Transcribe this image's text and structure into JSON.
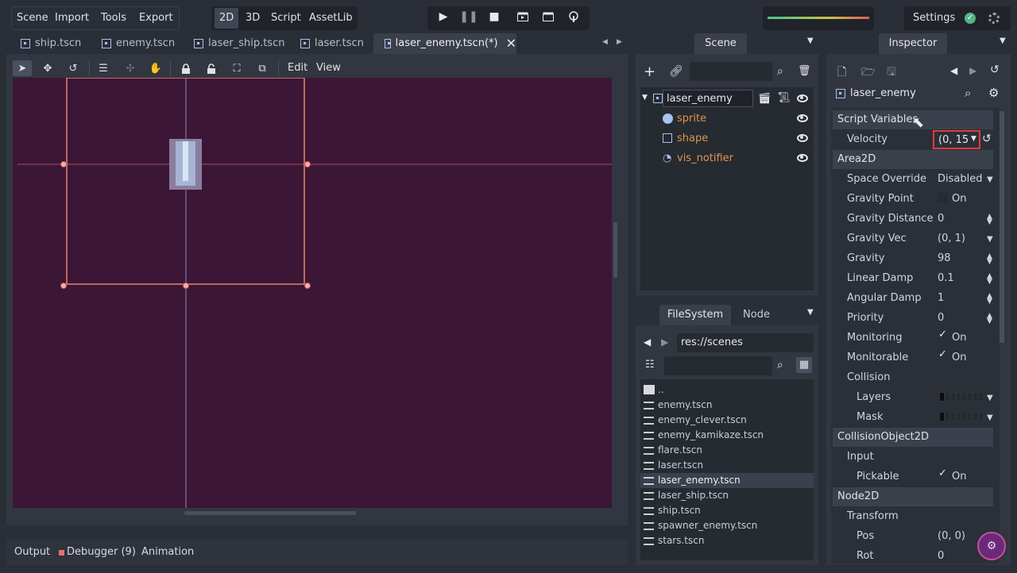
{
  "menu": {
    "scene": "Scene",
    "import": "Import",
    "tools": "Tools",
    "export": "Export"
  },
  "modes": {
    "m2d": "2D",
    "m3d": "3D",
    "script": "Script",
    "assetlib": "AssetLib"
  },
  "settings_label": "Settings",
  "tabs": [
    {
      "label": "ship.tscn"
    },
    {
      "label": "enemy.tscn"
    },
    {
      "label": "laser_ship.tscn"
    },
    {
      "label": "laser.tscn"
    },
    {
      "label": "laser_enemy.tscn(*)"
    }
  ],
  "toolbar": {
    "edit": "Edit",
    "view": "View"
  },
  "bottom": {
    "output": "Output",
    "debugger": "Debugger (9)",
    "animation": "Animation"
  },
  "scene_dock": {
    "tab": "Scene",
    "nodes": [
      {
        "label": "laser_enemy"
      },
      {
        "label": "sprite"
      },
      {
        "label": "shape"
      },
      {
        "label": "vis_notifier"
      }
    ]
  },
  "fs_dock": {
    "tab_fs": "FileSystem",
    "tab_node": "Node",
    "path": "res://scenes",
    "files": [
      "..",
      "enemy.tscn",
      "enemy_clever.tscn",
      "enemy_kamikaze.tscn",
      "flare.tscn",
      "laser.tscn",
      "laser_enemy.tscn",
      "laser_ship.tscn",
      "ship.tscn",
      "spawner_enemy.tscn",
      "stars.tscn"
    ],
    "selected_index": 6
  },
  "inspector": {
    "tab": "Inspector",
    "node": "laser_enemy",
    "sections": {
      "script_vars": "Script Variables",
      "area2d": "Area2D",
      "collision_object": "CollisionObject2D",
      "node2d": "Node2D"
    },
    "props": {
      "velocity": {
        "label": "Velocity",
        "value": "(0, 15"
      },
      "space_override": {
        "label": "Space Override",
        "value": "Disabled"
      },
      "gravity_point": {
        "label": "Gravity Point",
        "value": "On"
      },
      "gravity_distance": {
        "label": "Gravity Distance Sc",
        "value": "0"
      },
      "gravity_vec": {
        "label": "Gravity Vec",
        "value": "(0, 1)"
      },
      "gravity": {
        "label": "Gravity",
        "value": "98"
      },
      "linear_damp": {
        "label": "Linear Damp",
        "value": "0.1"
      },
      "angular_damp": {
        "label": "Angular Damp",
        "value": "1"
      },
      "priority": {
        "label": "Priority",
        "value": "0"
      },
      "monitoring": {
        "label": "Monitoring",
        "value": "On"
      },
      "monitorable": {
        "label": "Monitorable",
        "value": "On"
      },
      "collision": {
        "label": "Collision"
      },
      "layers": {
        "label": "Layers"
      },
      "mask": {
        "label": "Mask"
      },
      "input": {
        "label": "Input"
      },
      "pickable": {
        "label": "Pickable",
        "value": "On"
      },
      "transform": {
        "label": "Transform"
      },
      "pos": {
        "label": "Pos",
        "value": "(0, 0)"
      },
      "rot": {
        "label": "Rot",
        "value": "0"
      }
    }
  },
  "colors": {
    "viewport": "#3c1636",
    "accent_orange": "#e0954f",
    "highlight_red": "#e03a3a"
  }
}
